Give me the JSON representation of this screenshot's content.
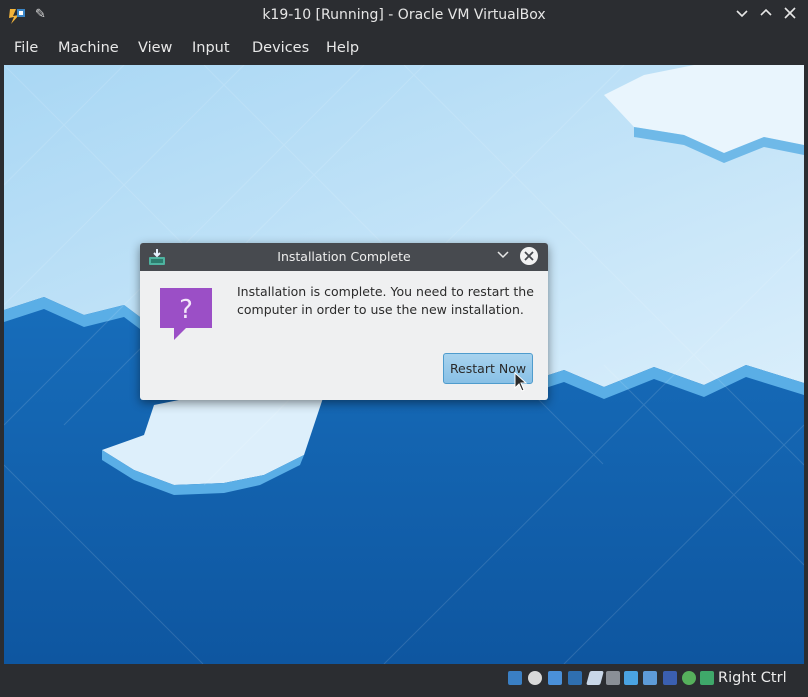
{
  "window": {
    "title": "k19-10 [Running] - Oracle VM VirtualBox",
    "icons": [
      "virtualbox-icon",
      "pin-icon",
      "minimize-icon",
      "maximize-icon",
      "close-icon"
    ]
  },
  "menubar": {
    "items": [
      "File",
      "Machine",
      "View",
      "Input",
      "Devices",
      "Help"
    ]
  },
  "dialog": {
    "title": "Installation Complete",
    "message": "Installation is complete. You need to restart the computer in order to use the new installation.",
    "button": "Restart Now",
    "icons": [
      "installer-icon",
      "chevron-down-icon",
      "close-icon",
      "question-icon"
    ]
  },
  "statusbar": {
    "host_key": "Right Ctrl",
    "icons": [
      "hard-disk-icon",
      "optical-drive-icon",
      "audio-icon",
      "network-icon",
      "usb-icon",
      "shared-folders-icon",
      "display-icon",
      "video-capture-icon",
      "vt-x-icon",
      "guest-additions-icon",
      "mouse-integration-icon"
    ]
  },
  "colors": {
    "desktop_blue": "#1565ad",
    "dialog_bg": "#eff0f1",
    "titlebar": "#2b2d31",
    "accent_purple": "#9b4fc6"
  }
}
